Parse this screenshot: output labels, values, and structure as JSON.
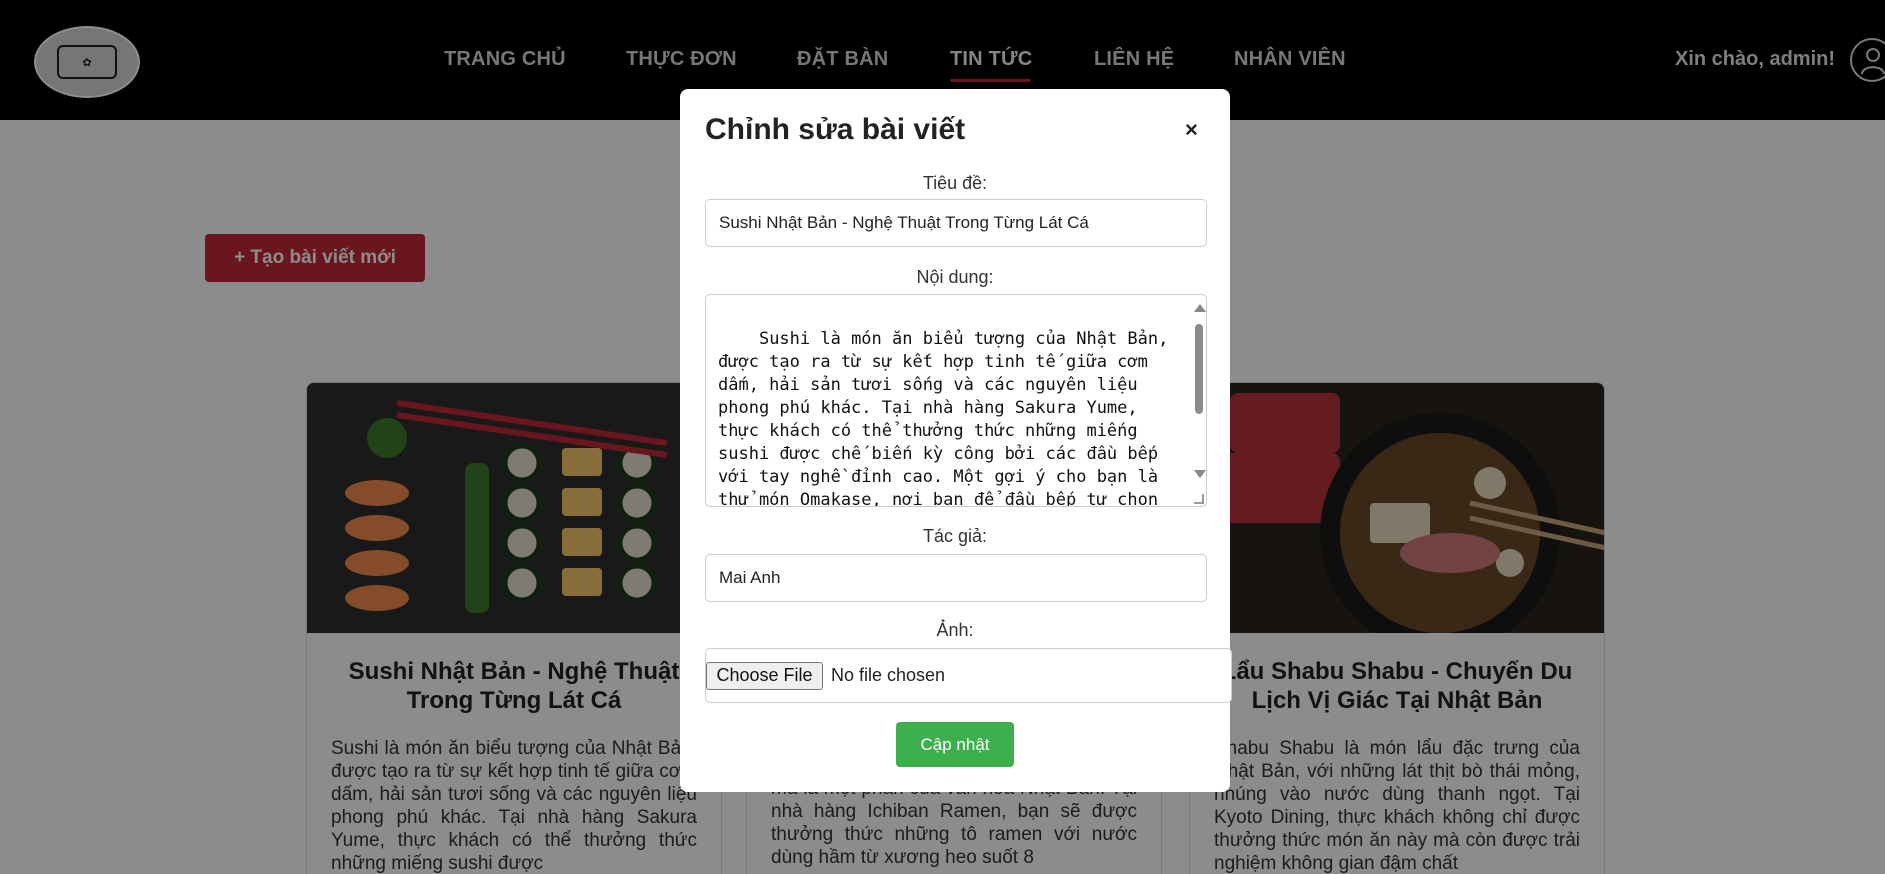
{
  "header": {
    "logo_alt": "SAKURA YUME",
    "nav": [
      {
        "label": "TRANG CHỦ"
      },
      {
        "label": "THỰC ĐƠN"
      },
      {
        "label": "ĐẶT BÀN"
      },
      {
        "label": "TIN TỨC"
      },
      {
        "label": "LIÊN HỆ"
      },
      {
        "label": "NHÂN VIÊN"
      }
    ],
    "active_nav": "TIN TỨC",
    "greeting": "Xin chào, admin!"
  },
  "main": {
    "new_post_button": "+ Tạo bài viết mới",
    "cards": [
      {
        "title": "Sushi Nhật Bản - Nghệ Thuật Trong Từng Lát Cá",
        "body": "Sushi là món ăn biểu tượng của Nhật Bản, được tạo ra từ sự kết hợp tinh tế giữa cơm dấm, hải sản tươi sống và các nguyên liệu phong phú khác. Tại nhà hàng Sakura Yume, thực khách có thể thưởng thức những miếng sushi được"
      },
      {
        "title": "",
        "body": "mà là một phần của văn hóa Nhật Bản. Tại nhà hàng Ichiban Ramen, bạn sẽ được thưởng thức những tô ramen với nước dùng hầm từ xương heo suốt 8"
      },
      {
        "title": "Lẩu Shabu Shabu - Chuyến Du Lịch Vị Giác Tại Nhật Bản",
        "body": "Shabu Shabu là món lẩu đặc trưng của Nhật Bản, với những lát thịt bò thái mỏng, nhúng vào nước dùng thanh ngọt. Tại Kyoto Dining, thực khách không chỉ được thưởng thức món ăn này mà còn được trải nghiệm không gian đậm chất"
      }
    ]
  },
  "modal": {
    "title": "Chỉnh sửa bài viết",
    "close": "×",
    "title_label": "Tiêu đề:",
    "title_value": "Sushi Nhật Bản - Nghệ Thuật Trong Từng Lát Cá",
    "content_label": "Nội dung:",
    "content_value": "Sushi là món ăn biểu tượng của Nhật Bản, được tạo ra từ sự kết hợp tinh tế giữa cơm dấm, hải sản tươi sống và các nguyên liệu phong phú khác. Tại nhà hàng Sakura Yume, thực khách có thể thưởng thức những miếng sushi được chế biến kỳ công bởi các đầu bếp với tay nghề đỉnh cao. Một gợi ý cho bạn là thử món Omakase, nơi bạn để đầu bếp tự chọn",
    "author_label": "Tác giả:",
    "author_value": "Mai Anh",
    "image_label": "Ảnh:",
    "file_button": "Choose File",
    "file_status": "No file chosen",
    "submit": "Cập nhật"
  },
  "colors": {
    "header_bg": "#000000",
    "accent_red": "#c0283a",
    "submit_green": "#3daf4c"
  }
}
